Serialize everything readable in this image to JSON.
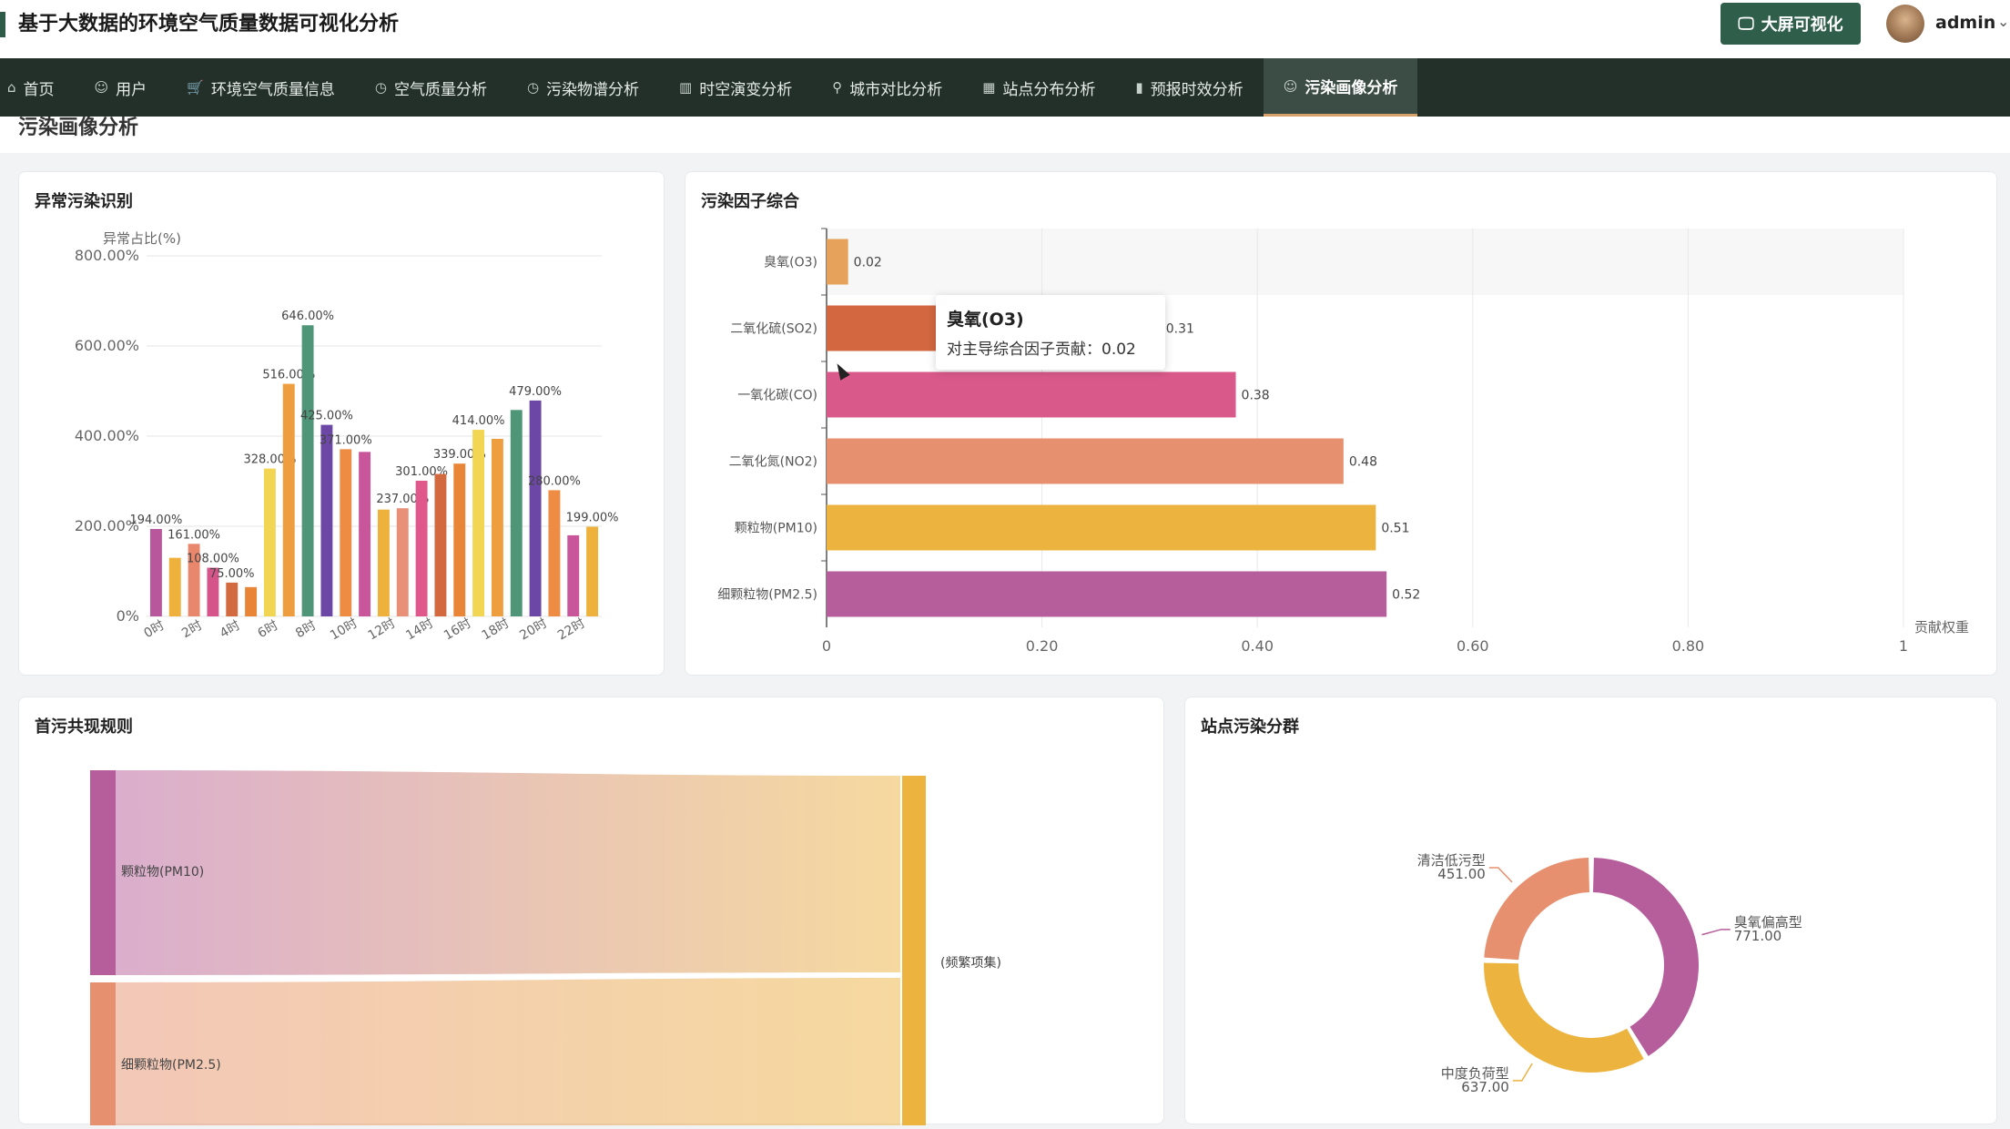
{
  "app": {
    "title": "基于大数据的环境空气质量数据可视化分析",
    "bigscreen_label": "大屏可视化",
    "user_name": "admin"
  },
  "nav": {
    "tabs": [
      {
        "label": "首页",
        "icon": "home-icon"
      },
      {
        "label": "用户",
        "icon": "user-icon"
      },
      {
        "label": "环境空气质量信息",
        "icon": "cart-icon"
      },
      {
        "label": "空气质量分析",
        "icon": "clock-icon"
      },
      {
        "label": "污染物谱分析",
        "icon": "clock-icon"
      },
      {
        "label": "时空演变分析",
        "icon": "building-icon"
      },
      {
        "label": "城市对比分析",
        "icon": "pin-icon"
      },
      {
        "label": "站点分布分析",
        "icon": "calendar-icon"
      },
      {
        "label": "预报时效分析",
        "icon": "bar-chart-icon"
      },
      {
        "label": "污染画像分析",
        "icon": "user-icon"
      }
    ],
    "active_index": 9
  },
  "page": {
    "breadcrumb": "污染画像分析"
  },
  "cards": {
    "anomaly_title": "异常污染识别",
    "factor_title": "污染因子综合",
    "cooccur_title": "首污共现规则",
    "cluster_title": "站点污染分群"
  },
  "tooltip": {
    "title": "臭氧(O3)",
    "text": "对主导综合因子贡献：0.02"
  },
  "chart_data": [
    {
      "type": "bar",
      "title": "异常污染识别",
      "ylabel": "异常占比(%)",
      "ylim": [
        0,
        800
      ],
      "yticks": [
        "0%",
        "200.00%",
        "400.00%",
        "600.00%",
        "800.00%"
      ],
      "categories": [
        "0时",
        "1时",
        "2时",
        "3时",
        "4时",
        "5时",
        "6时",
        "7时",
        "8时",
        "9时",
        "10时",
        "11时",
        "12时",
        "13时",
        "14时",
        "15时",
        "16时",
        "17时",
        "18时",
        "19时",
        "20时",
        "21时",
        "22时",
        "23时"
      ],
      "xtick_labels": [
        "0时",
        "2时",
        "4时",
        "6时",
        "8时",
        "10时",
        "12时",
        "14时",
        "16时",
        "18时",
        "20时",
        "22时"
      ],
      "series": [
        {
          "values": [
            194,
            130,
            161,
            108,
            75,
            65,
            328,
            516,
            646,
            425,
            371,
            365,
            237,
            240,
            301,
            316,
            339,
            414,
            394,
            458,
            479,
            280,
            180,
            199
          ]
        }
      ],
      "labeled_values": {
        "0": "194.00%",
        "2": "161.00%",
        "3": "108.00%",
        "4": "75.00%",
        "6": "328.00%",
        "7": "516.00%",
        "8": "646.00%",
        "9": "425.00%",
        "10": "371.00%",
        "13": "237.00%",
        "14": "301.00%",
        "16": "339.00%",
        "17": "414.00%",
        "20": "479.00%",
        "21": "280.00%",
        "23": "199.00%"
      },
      "colors": [
        "#b8579b",
        "#eeb13c",
        "#e9876d",
        "#d5558a",
        "#d36a3f",
        "#e98537",
        "#f2d553",
        "#ee9e3f",
        "#4f9678",
        "#6c47a6",
        "#ee8c44",
        "#c9559b",
        "#eeb13c",
        "#e89178",
        "#e0578c",
        "#d36a3f",
        "#e98537",
        "#f2d553",
        "#ee9e3f",
        "#4f9678",
        "#6c47a6",
        "#ee8c44",
        "#c9559b",
        "#eeb13c"
      ]
    },
    {
      "type": "bar",
      "orientation": "horizontal",
      "title": "污染因子综合",
      "xlabel": "贡献权重",
      "xlim": [
        0,
        1
      ],
      "xticks": [
        "0",
        "0.20",
        "0.40",
        "0.60",
        "0.80",
        "1"
      ],
      "categories": [
        "臭氧(O3)",
        "二氧化硫(SO2)",
        "一氧化碳(CO)",
        "二氧化氮(NO2)",
        "颗粒物(PM10)",
        "细颗粒物(PM2.5)"
      ],
      "values": [
        0.02,
        0.31,
        0.38,
        0.48,
        0.51,
        0.52
      ],
      "value_labels": [
        "0.02",
        "0.31",
        "0.38",
        "0.48",
        "0.51",
        "0.52"
      ],
      "colors": [
        "#e6a15a",
        "#d3673f",
        "#d9598a",
        "#e6906f",
        "#ecb33f",
        "#b65d9b"
      ]
    },
    {
      "type": "sankey",
      "title": "首污共现规则",
      "nodes": [
        "颗粒物(PM10)",
        "细颗粒物(PM2.5)",
        "(频繁项集)"
      ],
      "links": [
        {
          "source": "颗粒物(PM10)",
          "target": "(频繁项集)"
        },
        {
          "source": "细颗粒物(PM2.5)",
          "target": "(频繁项集)"
        }
      ],
      "colors": [
        "#b65d9b",
        "#e6906f",
        "#ecb33f"
      ]
    },
    {
      "type": "pie",
      "donut": true,
      "title": "站点污染分群",
      "slices": [
        {
          "name": "臭氧偏高型",
          "value": 771.0,
          "label": "771.00",
          "color": "#b65d9b"
        },
        {
          "name": "中度负荷型",
          "value": 637.0,
          "label": "637.00",
          "color": "#ecb33f"
        },
        {
          "name": "清洁低污型",
          "value": 451.0,
          "label": "451.00",
          "color": "#e6906f"
        }
      ]
    }
  ]
}
